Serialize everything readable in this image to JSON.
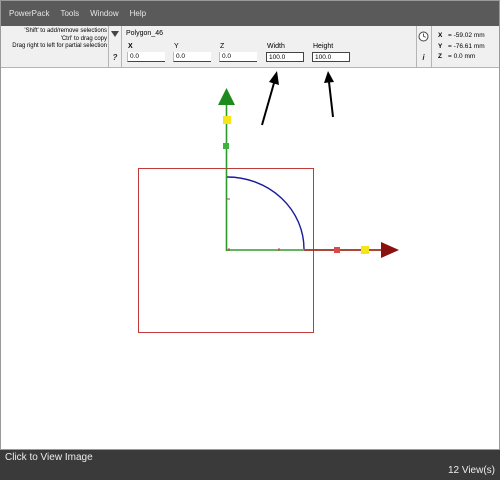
{
  "menu": [
    "PowerPack",
    "Tools",
    "Window",
    "Help"
  ],
  "hints": [
    "'Shift' to add/remove selections",
    "'Ctrl' to drag copy",
    "Drag right to left for partial selection"
  ],
  "toolbar": {
    "object_name": "Polygon_46",
    "help_label": "?",
    "info_label": "i",
    "fields": {
      "x": {
        "label": "X",
        "value": "0.0"
      },
      "y": {
        "label": "Y",
        "value": "0.0"
      },
      "z": {
        "label": "Z",
        "value": "0.0"
      },
      "width": {
        "label": "Width",
        "value": "100.0"
      },
      "height": {
        "label": "Height",
        "value": "100.0"
      }
    }
  },
  "coords": {
    "x": {
      "label": "X",
      "value": "= -59.02 mm"
    },
    "y": {
      "label": "Y",
      "value": "= -76.61 mm"
    },
    "z": {
      "label": "Z",
      "value": "= 0.0 mm"
    }
  },
  "footer": {
    "caption": "Click to View Image",
    "views": "12 View(s)"
  },
  "colors": {
    "menubar": "#5a5a5a",
    "toolbar": "#f0f0f0",
    "bounding_box": "#c0393b",
    "arc": "#1a1aa0",
    "y_axis": "#2e9a2e",
    "x_axis": "#b01c1c",
    "handle_yellow": "#f5e51b",
    "annotation_arrow": "#000000"
  },
  "icons": [
    "dropdown-triangle-icon",
    "help-icon",
    "clock-icon",
    "info-icon",
    "y-axis-arrow-icon",
    "x-axis-arrow-icon"
  ]
}
